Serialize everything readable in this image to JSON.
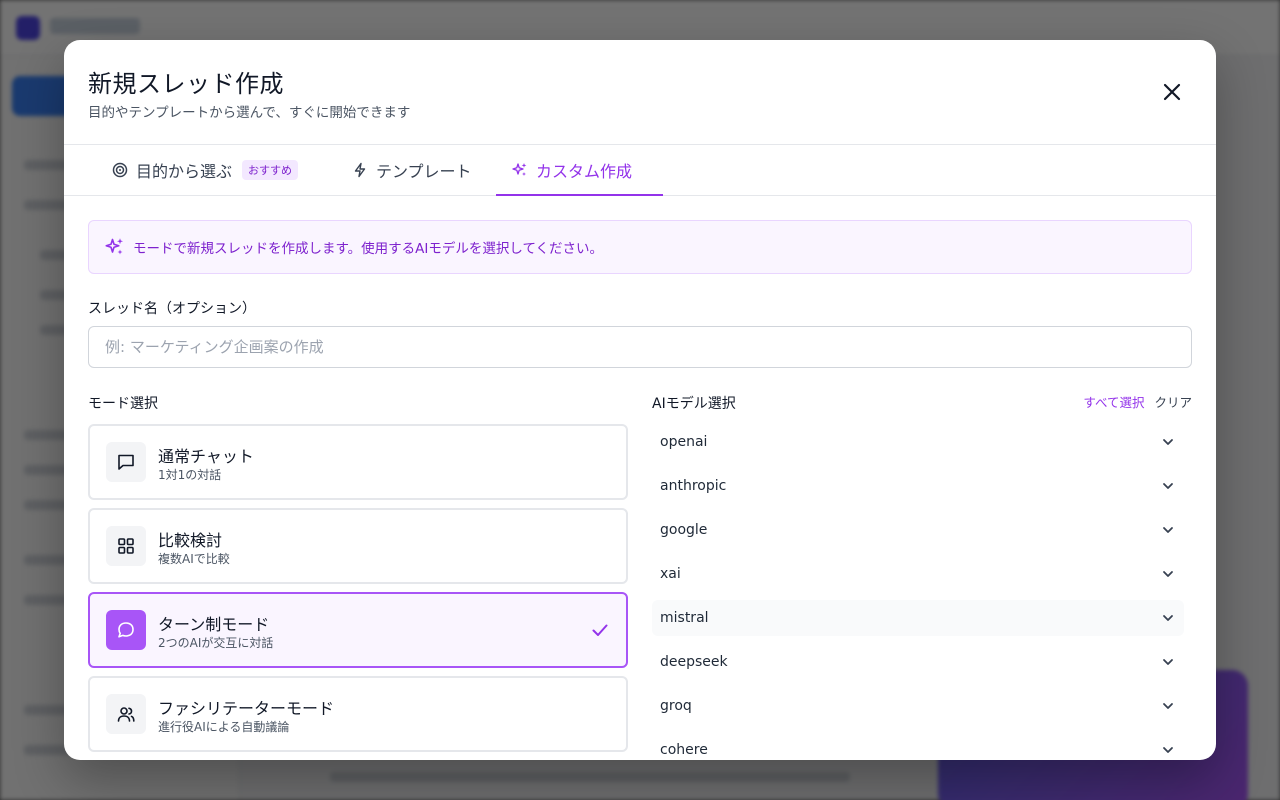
{
  "modal": {
    "title": "新規スレッド作成",
    "subtitle": "目的やテンプレートから選んで、すぐに開始できます"
  },
  "tabs": [
    {
      "label": "目的から選ぶ",
      "badge": "おすすめ",
      "icon": "target-icon"
    },
    {
      "label": "テンプレート",
      "icon": "lightning-icon"
    },
    {
      "label": "カスタム作成",
      "icon": "sparkles-icon",
      "active": true
    }
  ],
  "info": {
    "text": "モードで新規スレッドを作成します。使用するAIモデルを選択してください。"
  },
  "thread_name": {
    "label": "スレッド名（オプション）",
    "placeholder": "例: マーケティング企画案の作成",
    "value": ""
  },
  "mode_select": {
    "label": "モード選択",
    "modes": [
      {
        "title": "通常チャット",
        "desc": "1対1の対話",
        "icon": "chat-bubble-icon",
        "selected": false
      },
      {
        "title": "比較検討",
        "desc": "複数AIで比較",
        "icon": "grid-icon",
        "selected": false
      },
      {
        "title": "ターン制モード",
        "desc": "2つのAIが交互に対話",
        "icon": "speech-bubble-icon",
        "selected": true
      },
      {
        "title": "ファシリテーターモード",
        "desc": "進行役AIによる自動議論",
        "icon": "users-icon",
        "selected": false
      }
    ]
  },
  "ai_select": {
    "label": "AIモデル選択",
    "select_all": "すべて選択",
    "clear": "クリア",
    "providers": [
      "openai",
      "anthropic",
      "google",
      "xai",
      "mistral",
      "deepseek",
      "groq",
      "cohere"
    ]
  },
  "colors": {
    "accent": "#9333ea",
    "accent_light": "#faf5ff",
    "border": "#e5e7eb"
  }
}
